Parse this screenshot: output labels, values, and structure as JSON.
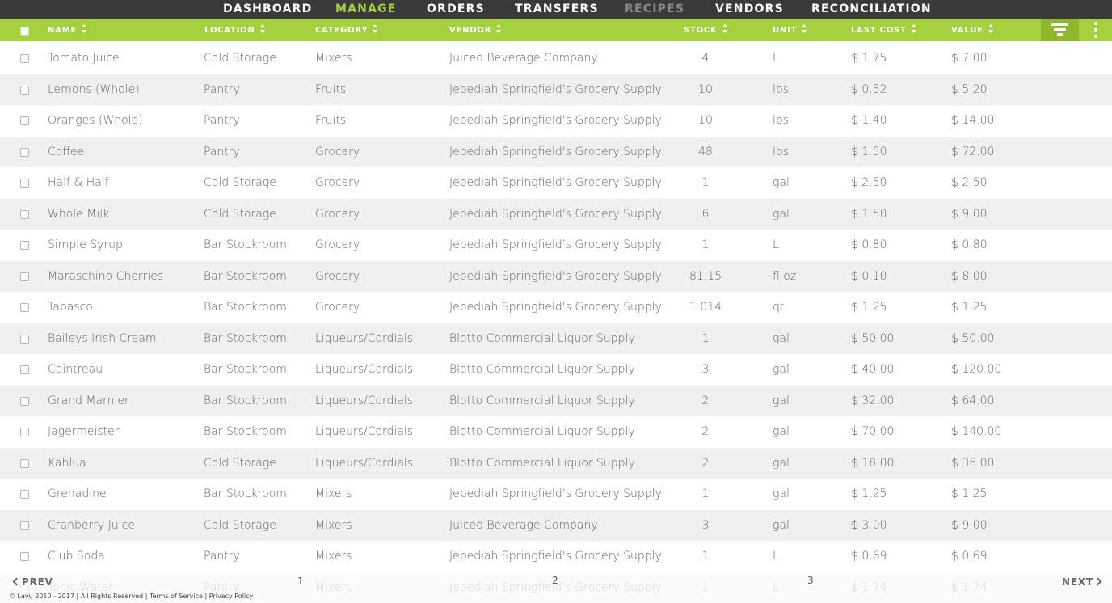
{
  "nav": {
    "items": [
      {
        "label": "DASHBOARD"
      },
      {
        "label": "MANAGE"
      },
      {
        "label": "ORDERS"
      },
      {
        "label": "TRANSFERS"
      },
      {
        "label": "RECIPES"
      },
      {
        "label": "VENDORS"
      },
      {
        "label": "RECONCILIATION"
      }
    ],
    "active": "MANAGE"
  },
  "table": {
    "columns": {
      "name": "NAME",
      "location": "LOCATION",
      "category": "CATEGORY",
      "vendor": "VENDOR",
      "stock": "STOCK",
      "unit": "UNIT",
      "last_cost": "LAST COST",
      "value": "VALUE"
    },
    "rows": [
      {
        "name": "Tomato Juice",
        "location": "Cold Storage",
        "category": "Mixers",
        "vendor": "Juiced Beverage Company",
        "stock": "4",
        "unit": "L",
        "last_cost": "$ 1.75",
        "value": "$ 7.00"
      },
      {
        "name": "Lemons (Whole)",
        "location": "Pantry",
        "category": "Fruits",
        "vendor": "Jebediah Springfield's Grocery Supply",
        "stock": "10",
        "unit": "lbs",
        "last_cost": "$ 0.52",
        "value": "$ 5.20"
      },
      {
        "name": "Oranges (Whole)",
        "location": "Pantry",
        "category": "Fruits",
        "vendor": "Jebediah Springfield's Grocery Supply",
        "stock": "10",
        "unit": "lbs",
        "last_cost": "$ 1.40",
        "value": "$ 14.00"
      },
      {
        "name": "Coffee",
        "location": "Pantry",
        "category": "Grocery",
        "vendor": "Jebediah Springfield's Grocery Supply",
        "stock": "48",
        "unit": "lbs",
        "last_cost": "$ 1.50",
        "value": "$ 72.00"
      },
      {
        "name": "Half & Half",
        "location": "Cold Storage",
        "category": "Grocery",
        "vendor": "Jebediah Springfield's Grocery Supply",
        "stock": "1",
        "unit": "gal",
        "last_cost": "$ 2.50",
        "value": "$ 2.50"
      },
      {
        "name": "Whole Milk",
        "location": "Cold Storage",
        "category": "Grocery",
        "vendor": "Jebediah Springfield's Grocery Supply",
        "stock": "6",
        "unit": "gal",
        "last_cost": "$ 1.50",
        "value": "$ 9.00"
      },
      {
        "name": "Simple Syrup",
        "location": "Bar Stockroom",
        "category": "Grocery",
        "vendor": "Jebediah Springfield's Grocery Supply",
        "stock": "1",
        "unit": "L",
        "last_cost": "$ 0.80",
        "value": "$ 0.80"
      },
      {
        "name": "Maraschino Cherries",
        "location": "Bar Stockroom",
        "category": "Grocery",
        "vendor": "Jebediah Springfield's Grocery Supply",
        "stock": "81.15",
        "unit": "fl oz",
        "last_cost": "$ 0.10",
        "value": "$ 8.00"
      },
      {
        "name": "Tabasco",
        "location": "Bar Stockroom",
        "category": "Grocery",
        "vendor": "Jebediah Springfield's Grocery Supply",
        "stock": "1.014",
        "unit": "qt",
        "last_cost": "$ 1.25",
        "value": "$ 1.25"
      },
      {
        "name": "Baileys Irish Cream",
        "location": "Bar Stockroom",
        "category": "Liqueurs/Cordials",
        "vendor": "Blotto Commercial Liquor Supply",
        "stock": "1",
        "unit": "gal",
        "last_cost": "$ 50.00",
        "value": "$ 50.00"
      },
      {
        "name": "Cointreau",
        "location": "Bar Stockroom",
        "category": "Liqueurs/Cordials",
        "vendor": "Blotto Commercial Liquor Supply",
        "stock": "3",
        "unit": "gal",
        "last_cost": "$ 40.00",
        "value": "$ 120.00"
      },
      {
        "name": "Grand Marnier",
        "location": "Bar Stockroom",
        "category": "Liqueurs/Cordials",
        "vendor": "Blotto Commercial Liquor Supply",
        "stock": "2",
        "unit": "gal",
        "last_cost": "$ 32.00",
        "value": "$ 64.00"
      },
      {
        "name": "Jagermeister",
        "location": "Bar Stockroom",
        "category": "Liqueurs/Cordials",
        "vendor": "Blotto Commercial Liquor Supply",
        "stock": "2",
        "unit": "gal",
        "last_cost": "$ 70.00",
        "value": "$ 140.00"
      },
      {
        "name": "Kahlua",
        "location": "Cold Storage",
        "category": "Liqueurs/Cordials",
        "vendor": "Blotto Commercial Liquor Supply",
        "stock": "2",
        "unit": "gal",
        "last_cost": "$ 18.00",
        "value": "$ 36.00"
      },
      {
        "name": "Grenadine",
        "location": "Bar Stockroom",
        "category": "Mixers",
        "vendor": "Jebediah Springfield's Grocery Supply",
        "stock": "1",
        "unit": "gal",
        "last_cost": "$ 1.25",
        "value": "$ 1.25"
      },
      {
        "name": "Cranberry Juice",
        "location": "Cold Storage",
        "category": "Mixers",
        "vendor": "Juiced Beverage Company",
        "stock": "3",
        "unit": "gal",
        "last_cost": "$ 3.00",
        "value": "$ 9.00"
      },
      {
        "name": "Club Soda",
        "location": "Pantry",
        "category": "Mixers",
        "vendor": "Jebediah Springfield's Grocery Supply",
        "stock": "1",
        "unit": "L",
        "last_cost": "$ 0.69",
        "value": "$ 0.69"
      },
      {
        "name": "Tonic Water",
        "location": "Pantry",
        "category": "Mixers",
        "vendor": "Jebediah Springfield's Grocery Supply",
        "stock": "1",
        "unit": "L",
        "last_cost": "$ 1.74",
        "value": "$ 1.74"
      }
    ]
  },
  "pagination": {
    "prev_label": "PREV",
    "next_label": "NEXT",
    "pages": [
      "1",
      "2",
      "3"
    ]
  },
  "footer": {
    "copyright": "© Lavu 2010 - 2017",
    "rights": "All Rights Reserved",
    "terms": "Terms of Service",
    "privacy": "Privacy Policy",
    "separator": "|"
  },
  "icons": {
    "sort": "sort-arrows-icon",
    "filter": "filter-icon",
    "more": "more-vertical-icon",
    "prev": "chevron-left-icon",
    "next": "chevron-right-icon"
  },
  "colors": {
    "accent": "#a6d13e",
    "nav_bg": "#3a3a3a",
    "row_alt": "#f0f0f0",
    "text": "#666666"
  }
}
